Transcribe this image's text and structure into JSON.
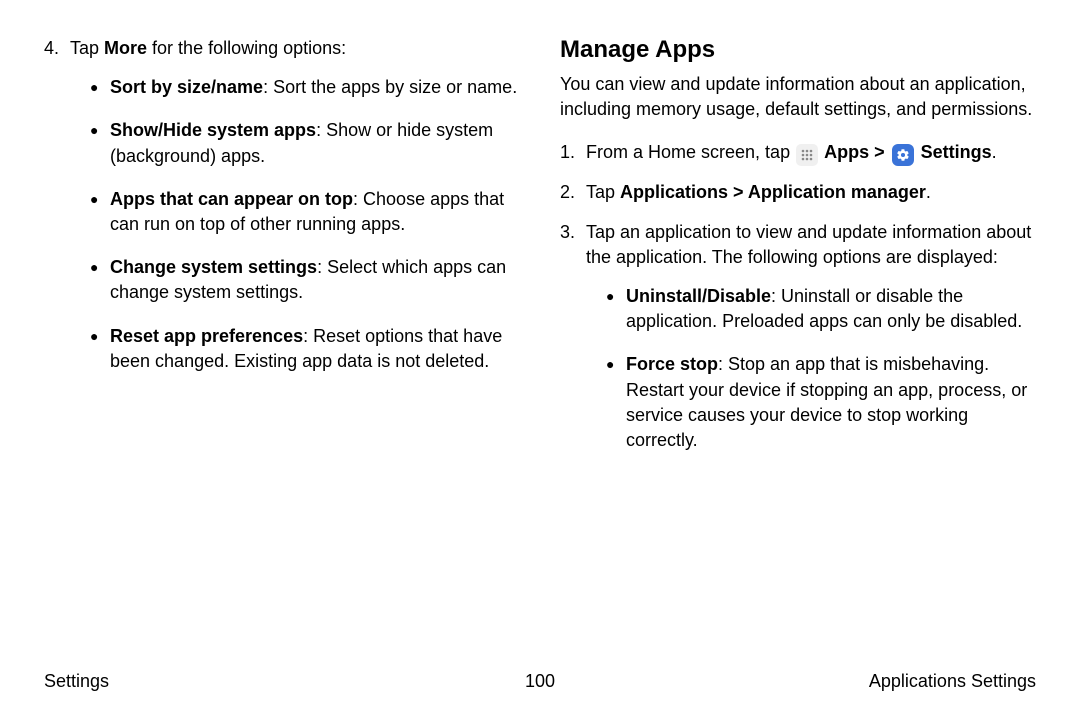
{
  "left": {
    "step4_num": "4.",
    "step4_intro_pre": "Tap ",
    "step4_intro_bold": "More",
    "step4_intro_post": " for the following options:",
    "bullets": [
      {
        "bold": "Sort by size/name",
        "rest": ": Sort the apps by size or name."
      },
      {
        "bold": "Show/Hide system apps",
        "rest": ": Show or hide system (background) apps."
      },
      {
        "bold": "Apps that can appear on top",
        "rest": ": Choose apps that can run on top of other running apps."
      },
      {
        "bold": "Change system settings",
        "rest": ": Select which apps can change system settings."
      },
      {
        "bold": "Reset app preferences",
        "rest": ": Reset options that have been changed. Existing app data is not deleted."
      }
    ]
  },
  "right": {
    "heading": "Manage Apps",
    "intro": "You can view and update information about an application, including memory usage, default settings, and permissions.",
    "step1_num": "1.",
    "step1_pre": "From a Home screen, tap ",
    "step1_apps_label": "Apps",
    "step1_sep": " > ",
    "step1_settings_label": "Settings",
    "step1_end": ".",
    "step2_num": "2.",
    "step2_pre": "Tap ",
    "step2_bold": "Applications > Application manager",
    "step2_end": ".",
    "step3_num": "3.",
    "step3_text": "Tap an application to view and update information about the application. The following options are displayed:",
    "bullets": [
      {
        "bold": "Uninstall/Disable",
        "rest": ": Uninstall or disable the application. Preloaded apps can only be disabled."
      },
      {
        "bold": "Force stop",
        "rest": ": Stop an app that is misbehaving. Restart your device if stopping an app, process, or service causes your device to stop working correctly."
      }
    ]
  },
  "footer": {
    "left": "Settings",
    "center": "100",
    "right": "Applications Settings"
  }
}
